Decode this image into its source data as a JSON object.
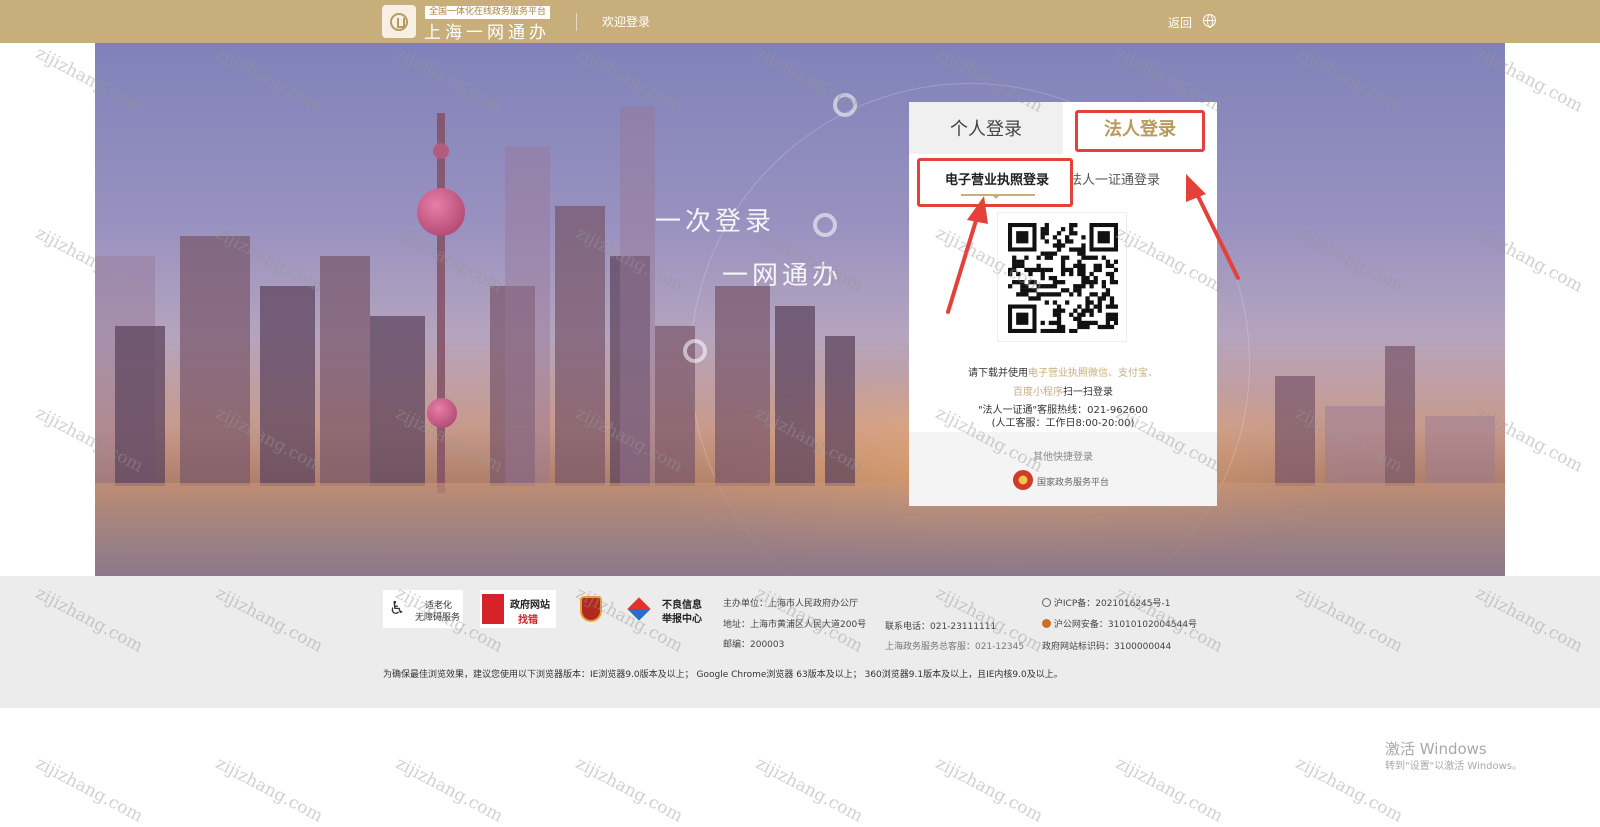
{
  "header": {
    "platform_slogan": "全国一体化在线政务服务平台",
    "brand_name": "上海一网通办",
    "welcome": "欢迎登录",
    "back_label": "返回",
    "accent_color": "#c8ae7a"
  },
  "hero": {
    "slogan_line1": "一次登录",
    "slogan_line2": "一网通办"
  },
  "login": {
    "tabs": [
      {
        "label": "个人登录",
        "active": false
      },
      {
        "label": "法人登录",
        "active": true
      }
    ],
    "sub_tabs": [
      {
        "label": "电子营业执照登录",
        "active": true
      },
      {
        "label": "法人一证通登录",
        "active": false
      }
    ],
    "qr_icon": "qr-code",
    "hint_prefix": "请下载并使用",
    "hint_apps_line1": "电子营业执照微信、支付宝、",
    "hint_apps_line2": "百度小程序",
    "hint_suffix": "扫一扫登录",
    "hotline": "\"法人一证通\"客服热线：021-962600",
    "service_hours": "(人工客服：工作日8:00-20:00)",
    "other_title": "其他快捷登录",
    "national_platform": "国家政务服务平台"
  },
  "annotations": {
    "highlight_color": "#e4413b"
  },
  "footer": {
    "badges": [
      {
        "line1": "适老化",
        "line2": "无障碍服务"
      },
      {
        "line1": "政府网站",
        "line2": "找错"
      },
      {
        "line1": "",
        "line2": ""
      },
      {
        "line1": "不良信息",
        "line2": "举报中心"
      }
    ],
    "sponsor": "主办单位：上海市人民政府办公厅",
    "address": "地址：上海市黄浦区人民大道200号",
    "postcode": "邮编：200003",
    "phone": "联系电话：021-23111111",
    "service_line": "上海政务服务总客服：021-12345",
    "icp": "沪ICP备：2021016245号-1",
    "police": "沪公网安备：31010102004544号",
    "site_code": "政府网站标识码：3100000044",
    "browser_notice": "为确保最佳浏览效果，建议您使用以下浏览器版本：IE浏览器9.0版本及以上；  Google Chrome浏览器 63版本及以上；  360浏览器9.1版本及以上，且IE内核9.0及以上。"
  },
  "windows_activation": {
    "line1": "激活 Windows",
    "line2": "转到\"设置\"以激活 Windows。"
  },
  "watermark": "zijizhang.com"
}
